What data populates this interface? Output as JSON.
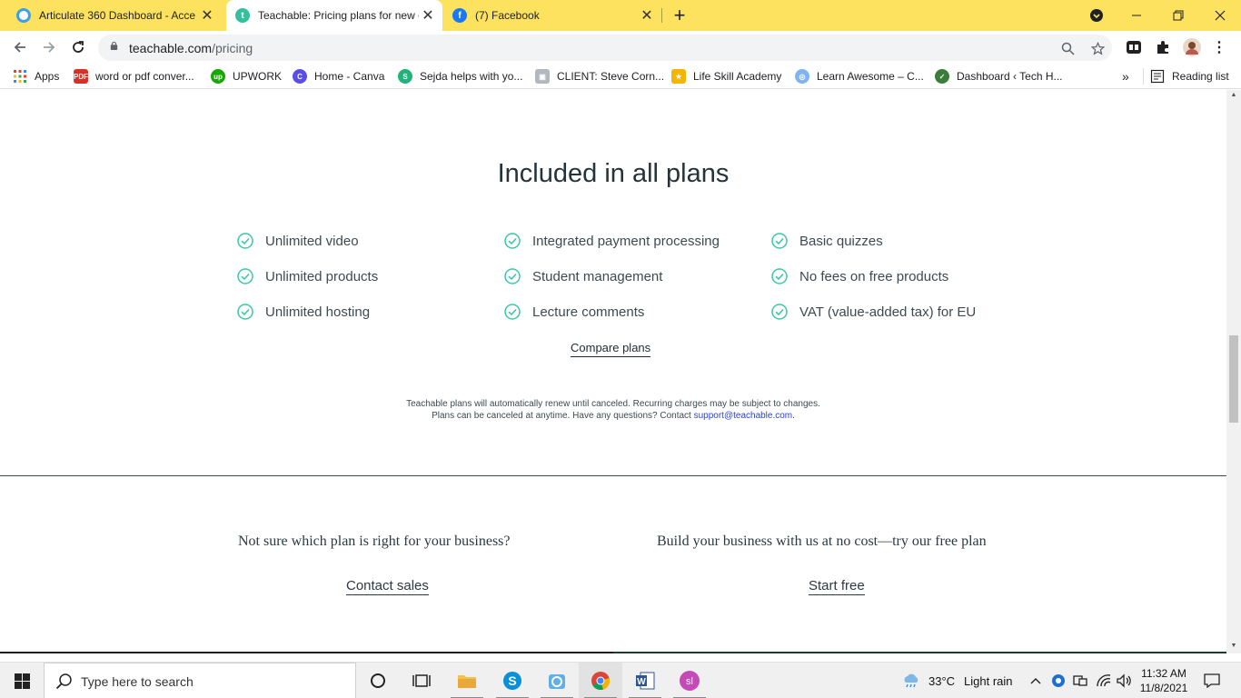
{
  "browser": {
    "tabs": [
      {
        "title": "Articulate 360 Dashboard - Acce",
        "active": false
      },
      {
        "title": "Teachable: Pricing plans for new c",
        "active": true
      },
      {
        "title": "(7) Facebook",
        "active": false
      }
    ],
    "new_tab_label": "+",
    "url_host": "teachable.com",
    "url_path": "/pricing",
    "bookmarks": [
      {
        "label": "Apps",
        "icon": "apps-grid-icon"
      },
      {
        "label": "word or pdf conver...",
        "icon": "pdf-icon"
      },
      {
        "label": "UPWORK",
        "icon": "upwork-icon"
      },
      {
        "label": "Home - Canva",
        "icon": "canva-icon"
      },
      {
        "label": "Sejda helps with yo...",
        "icon": "sejda-icon"
      },
      {
        "label": "CLIENT: Steve Corn...",
        "icon": "client-icon"
      },
      {
        "label": "Life Skill Academy",
        "icon": "academy-icon"
      },
      {
        "label": "Learn Awesome – C...",
        "icon": "learn-icon"
      },
      {
        "label": "Dashboard ‹ Tech H...",
        "icon": "dashboard-icon"
      }
    ],
    "bookmarks_overflow": "»",
    "reading_list": "Reading list"
  },
  "page": {
    "heading": "Included in all plans",
    "features": [
      [
        "Unlimited video",
        "Integrated payment processing",
        "Basic quizzes"
      ],
      [
        "Unlimited products",
        "Student management",
        "No fees on free products"
      ],
      [
        "Unlimited hosting",
        "Lecture comments",
        "VAT (value-added tax) for EU"
      ]
    ],
    "compare_link": "Compare plans",
    "note_line1": "Teachable plans will automatically renew until canceled. Recurring charges may be subject to changes.",
    "note_line2": "Plans can be canceled at anytime. Have any questions? Contact",
    "support_email": "support@teachable.com",
    "note_end": ".",
    "question_left": "Not sure which plan is right for your business?",
    "question_right": "Build your business with us at no cost—try our free plan",
    "cta_left": "Contact sales",
    "cta_right": "Start free"
  },
  "taskbar": {
    "search_placeholder": "Type here to search",
    "weather_temp": "33°C",
    "weather_desc": "Light rain",
    "time": "11:32 AM",
    "date": "11/8/2021"
  },
  "colors": {
    "tab_strip": "#fce25f",
    "check": "#3cc8a4",
    "link": "#2b3fd6",
    "heading": "#24343a"
  }
}
